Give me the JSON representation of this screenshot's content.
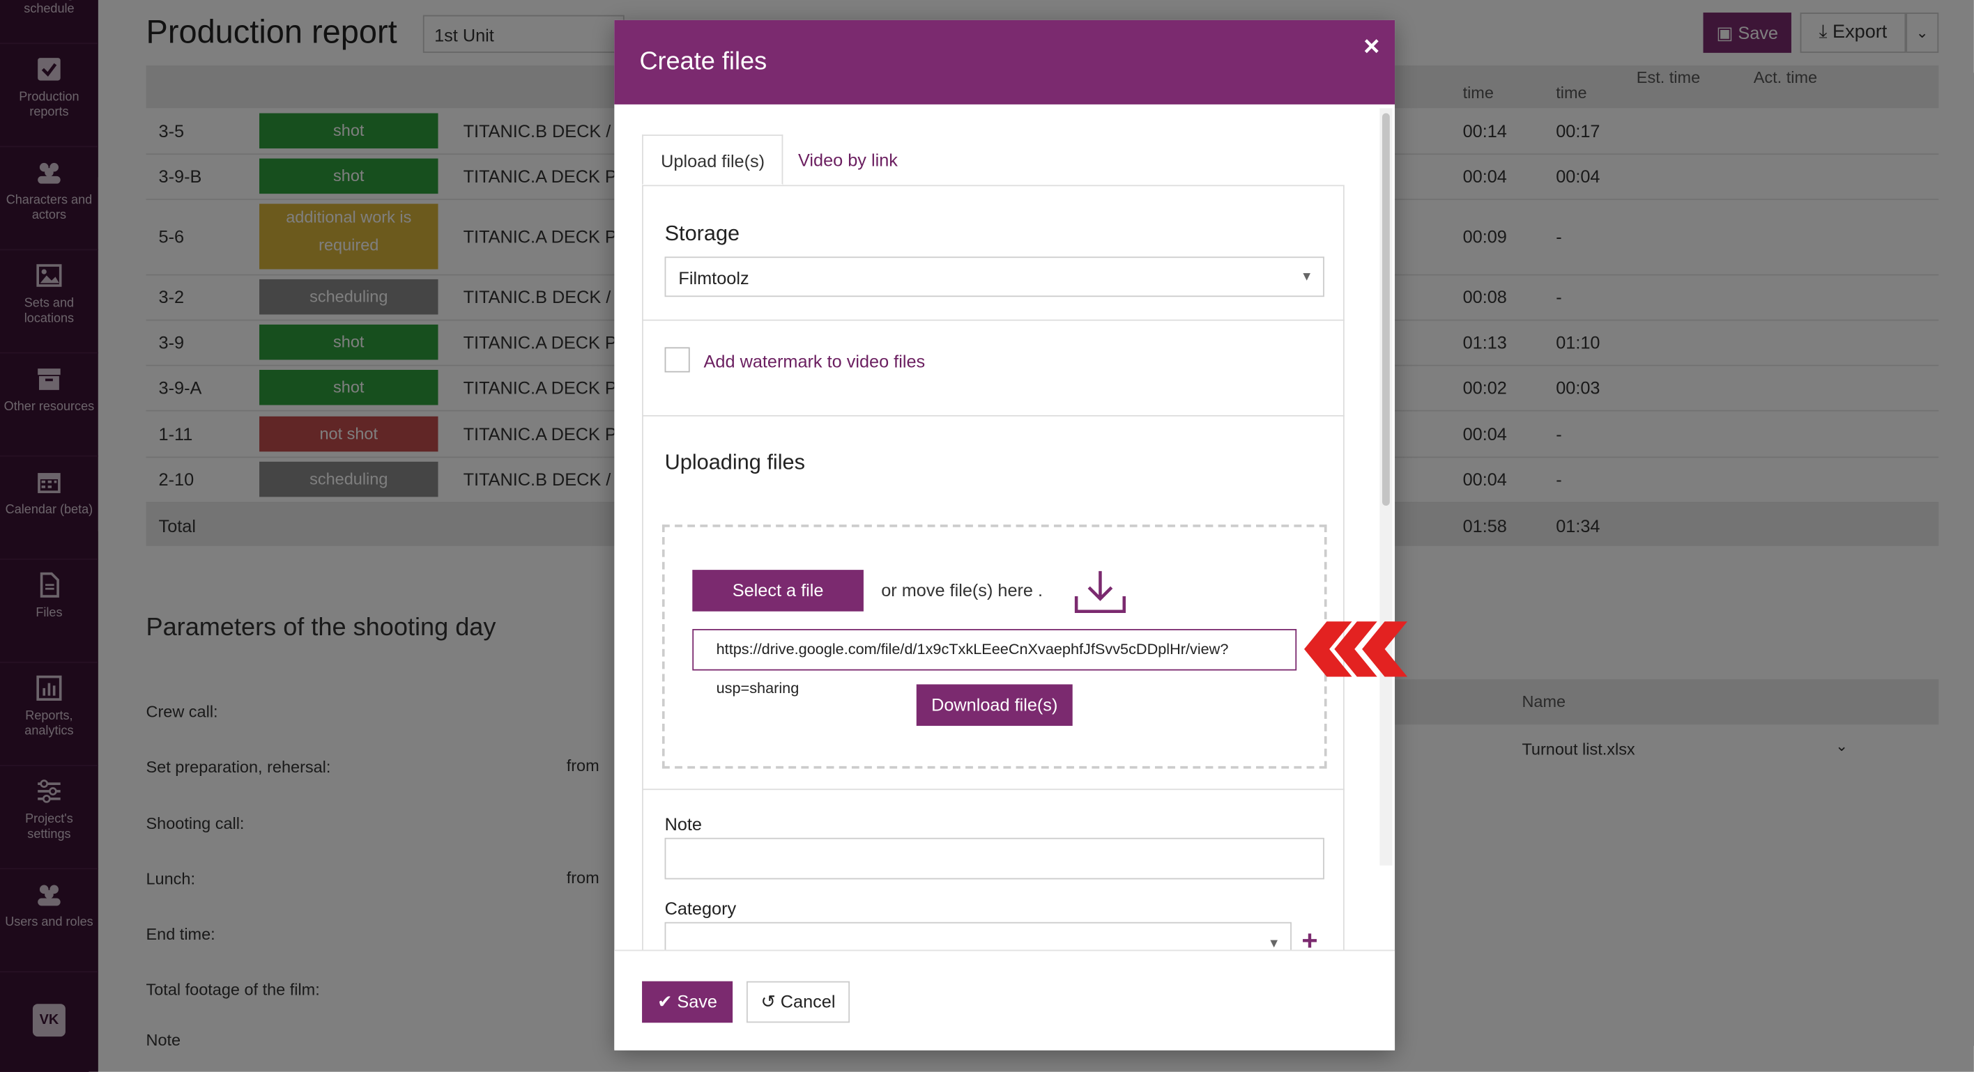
{
  "sidebar": {
    "items": [
      {
        "label": "Shooting schedule",
        "icon": "schedule-icon"
      },
      {
        "label": "Production reports",
        "icon": "checkbox-icon"
      },
      {
        "label": "Characters and actors",
        "icon": "people-icon"
      },
      {
        "label": "Sets and locations",
        "icon": "image-icon"
      },
      {
        "label": "Other resources",
        "icon": "archive-icon"
      },
      {
        "label": "Calendar (beta)",
        "icon": "calendar-icon"
      },
      {
        "label": "Files",
        "icon": "file-icon"
      },
      {
        "label": "Reports, analytics",
        "icon": "bar-chart-icon"
      },
      {
        "label": "Project's settings",
        "icon": "sliders-icon"
      },
      {
        "label": "Users and roles",
        "icon": "users-icon"
      }
    ],
    "vk": "VK"
  },
  "page": {
    "title": "Production report",
    "unit": "1st Unit",
    "save_label": "Save",
    "export_label": "Export",
    "headers": {
      "time1": "time",
      "time2": "time",
      "est": "Est. time",
      "act": "Act. time"
    },
    "rows": [
      {
        "scene": "3-5",
        "status": "shot",
        "status_color": "#2e9e3c",
        "location": "TITANIC.B DECK / Ro",
        "t1": "00:14",
        "t2": "00:17"
      },
      {
        "scene": "3-9-B",
        "status": "shot",
        "status_color": "#2e9e3c",
        "location": "TITANIC.A DECK PRO",
        "t1": "00:04",
        "t2": "00:04"
      },
      {
        "scene": "5-6",
        "status": "additional work is required",
        "status_color": "#d9b53a",
        "location": "TITANIC.A DECK PRO",
        "t1": "00:09",
        "t2": "-"
      },
      {
        "scene": "3-2",
        "status": "scheduling",
        "status_color": "#8a8a8a",
        "location": "TITANIC.B DECK / Ro",
        "t1": "00:08",
        "t2": "-"
      },
      {
        "scene": "3-9",
        "status": "shot",
        "status_color": "#2e9e3c",
        "location": "TITANIC.A DECK PRO",
        "t1": "01:13",
        "t2": "01:10"
      },
      {
        "scene": "3-9-A",
        "status": "shot",
        "status_color": "#2e9e3c",
        "location": "TITANIC.A DECK PRO",
        "t1": "00:02",
        "t2": "00:03"
      },
      {
        "scene": "1-11",
        "status": "not shot",
        "status_color": "#c34d4d",
        "location": "TITANIC.A DECK PRO",
        "t1": "00:04",
        "t2": "-"
      },
      {
        "scene": "2-10",
        "status": "scheduling",
        "status_color": "#8a8a8a",
        "location": "TITANIC.B DECK / Ro",
        "t1": "00:04",
        "t2": "-"
      }
    ],
    "total": {
      "label": "Total",
      "t1": "01:58",
      "t2": "01:34"
    },
    "params_title": "Parameters of the shooting day",
    "params": [
      {
        "label": "Crew call:",
        "from": ""
      },
      {
        "label": "Set preparation, rehersal:",
        "from": "from"
      },
      {
        "label": "Shooting call:",
        "from": ""
      },
      {
        "label": "Lunch:",
        "from": "from"
      },
      {
        "label": "End time:",
        "from": ""
      },
      {
        "label": "Total footage of the film:",
        "from": ""
      }
    ],
    "note_label": "Note",
    "files": {
      "name_header": "Name",
      "file_name": "Turnout list.xlsx"
    }
  },
  "modal": {
    "title": "Create files",
    "close": "×",
    "tabs": [
      {
        "label": "Upload file(s)",
        "active": true
      },
      {
        "label": "Video by link",
        "active": false
      }
    ],
    "storage": {
      "title": "Storage",
      "value": "Filmtoolz"
    },
    "watermark_label": "Add watermark to video files",
    "uploading_title": "Uploading files",
    "select_file_label": "Select a file",
    "or_move_text": "or move file(s) here .",
    "url_value": "https://drive.google.com/file/d/1x9cTxkLEeeCnXvaephfJfSvv5cDDplHr/view?usp=sharing",
    "download_label": "Download file(s)",
    "note_label": "Note",
    "category_label": "Category",
    "save_label": "Save",
    "cancel_label": "Cancel"
  },
  "colors": {
    "brand": "#7b2a6f",
    "sidebar": "#3a1234",
    "arrow": "#e32221"
  }
}
